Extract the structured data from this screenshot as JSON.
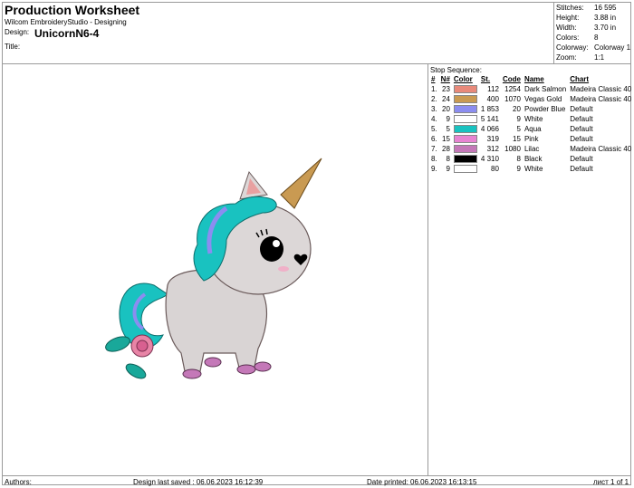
{
  "header": {
    "title": "Production Worksheet",
    "subtitle": "Wilcom EmbroideryStudio - Designing",
    "design_label": "Design:",
    "design_name": "UnicornN6-4",
    "title_label": "Title:"
  },
  "stats": [
    {
      "label": "Stitches:",
      "value": "16 595"
    },
    {
      "label": "Height:",
      "value": "3.88 in"
    },
    {
      "label": "Width:",
      "value": "3.70 in"
    },
    {
      "label": "Colors:",
      "value": "8"
    },
    {
      "label": "Colorway:",
      "value": "Colorway 1"
    },
    {
      "label": "Zoom:",
      "value": "1:1"
    }
  ],
  "stop_sequence": {
    "title": "Stop Sequence:",
    "headers": [
      "#",
      "N#",
      "Color",
      "St.",
      "Code",
      "Name",
      "Chart"
    ],
    "rows": [
      {
        "idx": "1.",
        "n": "23",
        "color": "#e8897a",
        "st": "112",
        "code": "1254",
        "name": "Dark Salmon",
        "chart": "Madeira Classic 40"
      },
      {
        "idx": "2.",
        "n": "24",
        "color": "#c99a52",
        "st": "400",
        "code": "1070",
        "name": "Vegas Gold",
        "chart": "Madeira Classic 40"
      },
      {
        "idx": "3.",
        "n": "20",
        "color": "#8b8df0",
        "st": "1 853",
        "code": "20",
        "name": "Powder Blue",
        "chart": "Default"
      },
      {
        "idx": "4.",
        "n": "9",
        "color": "#ffffff",
        "st": "5 141",
        "code": "9",
        "name": "White",
        "chart": "Default"
      },
      {
        "idx": "5.",
        "n": "5",
        "color": "#19c2c0",
        "st": "4 066",
        "code": "5",
        "name": "Aqua",
        "chart": "Default"
      },
      {
        "idx": "6.",
        "n": "15",
        "color": "#e884d2",
        "st": "319",
        "code": "15",
        "name": "Pink",
        "chart": "Default"
      },
      {
        "idx": "7.",
        "n": "28",
        "color": "#c478b8",
        "st": "312",
        "code": "1080",
        "name": "Lilac",
        "chart": "Madeira Classic 40"
      },
      {
        "idx": "8.",
        "n": "8",
        "color": "#000000",
        "st": "4 310",
        "code": "8",
        "name": "Black",
        "chart": "Default"
      },
      {
        "idx": "9.",
        "n": "9",
        "color": "#ffffff",
        "st": "80",
        "code": "9",
        "name": "White",
        "chart": "Default"
      }
    ]
  },
  "footer": {
    "authors": "Authors:",
    "saved": "Design last saved : 06.06.2023 16:12:39",
    "printed": "Date printed: 06.06.2023 16:13:15",
    "page": "лист 1 of 1"
  }
}
